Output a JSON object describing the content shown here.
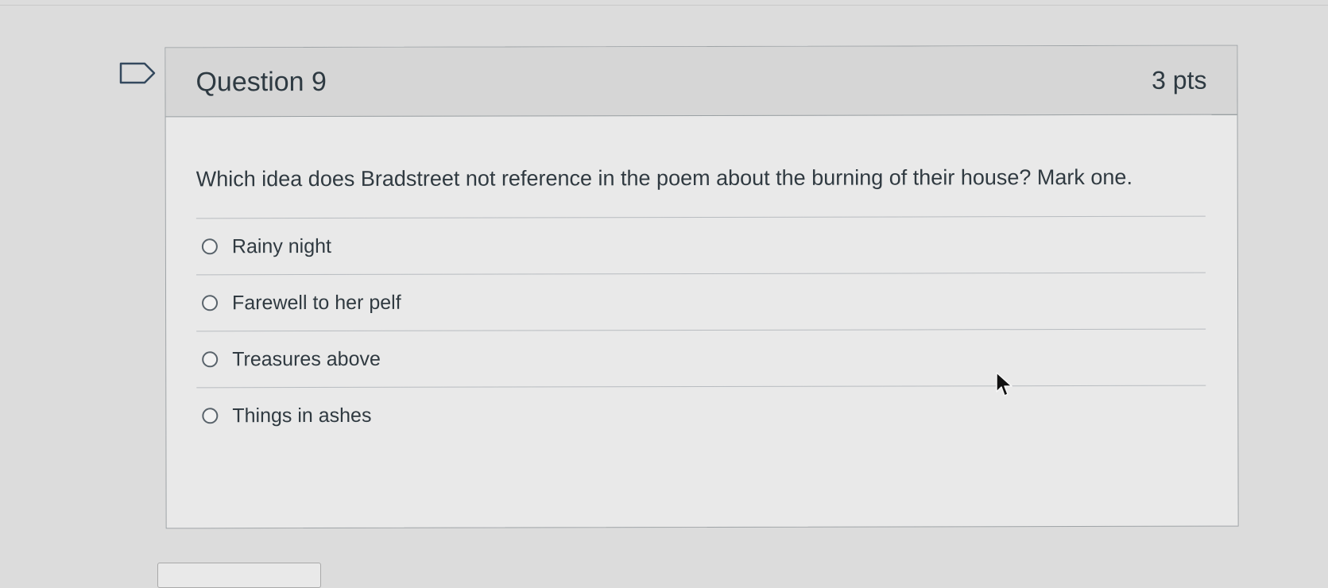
{
  "question": {
    "title": "Question 9",
    "points": "3 pts",
    "text": "Which idea does Bradstreet not reference in the poem about the burning of their house? Mark one."
  },
  "answers": [
    {
      "label": "Rainy night",
      "selected": false
    },
    {
      "label": "Farewell to her pelf",
      "selected": false
    },
    {
      "label": "Treasures above",
      "selected": false
    },
    {
      "label": "Things in ashes",
      "selected": false
    }
  ],
  "icons": {
    "flag": "flag-icon",
    "pointer": "mouse-pointer-icon"
  },
  "colors": {
    "background": "#dcdcdc",
    "card": "#e9e9e9",
    "header": "#d6d6d6",
    "text": "#2d3b45",
    "border": "#9ea3a6"
  }
}
